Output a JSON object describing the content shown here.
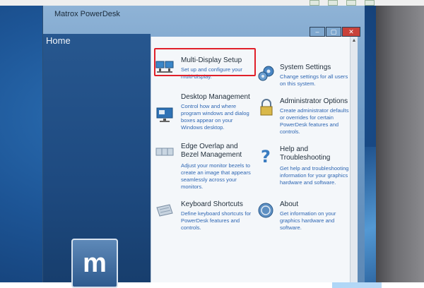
{
  "window": {
    "title": "Matrox PowerDesk",
    "minimize": "–",
    "maximize": "▢",
    "close": "✕"
  },
  "sidebar": {
    "title": "Home",
    "logo_letter": "m"
  },
  "items": {
    "multi_display": {
      "title": "Multi-Display Setup",
      "desc": "Set up and configure your multi-display."
    },
    "desktop_mgmt": {
      "title": "Desktop Management",
      "desc": "Control how and where program windows and dialog boxes appear on your Windows desktop."
    },
    "edge_overlap": {
      "title": "Edge Overlap and Bezel Management",
      "desc": "Adjust your monitor bezels to create an image that appears seamlessly across your monitors."
    },
    "keyboard": {
      "title": "Keyboard Shortcuts",
      "desc": "Define keyboard shortcuts for PowerDesk features and controls."
    },
    "system_settings": {
      "title": "System Settings",
      "desc": "Change settings for all users on this system."
    },
    "admin_options": {
      "title": "Administrator Options",
      "desc": "Create administrator defaults or overrides for certain PowerDesk features and controls."
    },
    "help": {
      "title": "Help and Troubleshooting",
      "desc": "Get help and troubleshooting information for your graphics hardware and software."
    },
    "about": {
      "title": "About",
      "desc": "Get information on your graphics hardware and software."
    }
  },
  "colors": {
    "highlight": "#e0202a",
    "link_blue": "#2f67b3"
  }
}
